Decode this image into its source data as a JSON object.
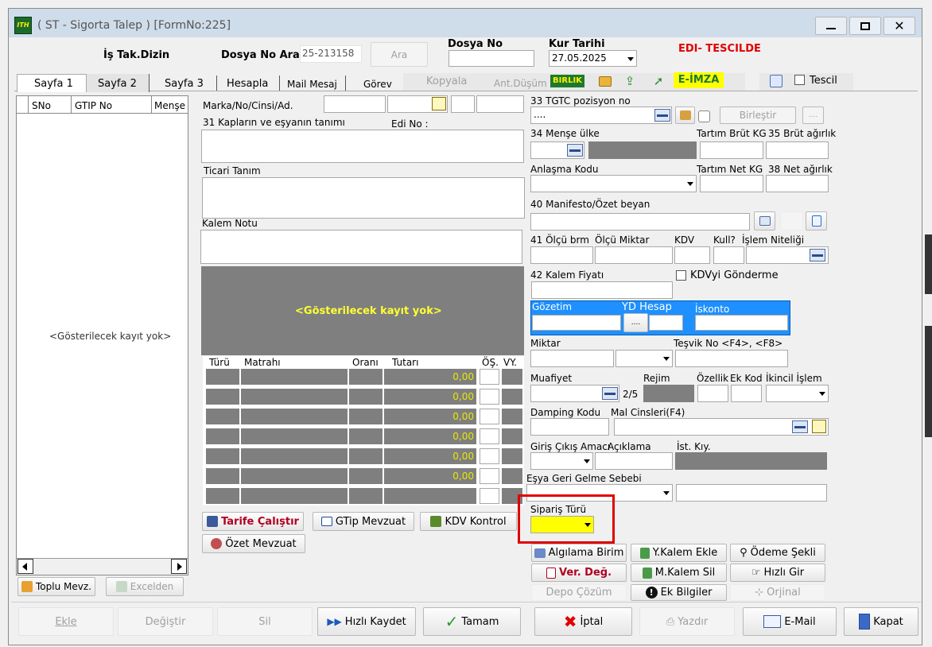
{
  "window": {
    "title": "( ST  - Sigorta Talep ) [FormNo:225]",
    "app_icon_text": "ITH"
  },
  "header": {
    "is_tak_dizin": "İş Tak.Dizin",
    "dosya_no_ara_label": "Dosya No Ara",
    "dosya_no_ara_value": "25-213158",
    "ara_button": "Ara",
    "dosya_no_label": "Dosya No",
    "dosya_no_value": "",
    "kur_tarihi_label": "Kur Tarihi",
    "kur_tarihi_value": "27.05.2025",
    "edi_status": "EDI- TESCILDE"
  },
  "tabs": [
    "Sayfa 1",
    "Sayfa 2",
    "Sayfa 3",
    "Hesapla",
    "Mail Mesaj",
    "Görev"
  ],
  "toolbar": {
    "kopyala": "Kopyala",
    "ant_dusum": "Ant.Düşüm",
    "birlik": "BIRLIK",
    "e_imza": "E-İMZA",
    "tescil": "Tescil"
  },
  "left_grid": {
    "columns": [
      "SNo",
      "GTIP No",
      "Menşe"
    ],
    "empty_text": "<Gösterilecek kayıt yok>",
    "toplu_mevz": "Toplu Mevz.",
    "excelden": "Excelden"
  },
  "mid": {
    "marka_label": "Marka/No/Cinsi/Ad.",
    "kaplar_label": "31 Kapların ve eşyanın tanımı",
    "edi_no_label": "Edi No :",
    "ticari_tanim_label": "Ticari Tanım",
    "kalem_notu_label": "Kalem Notu",
    "empty_text": "<Gösterilecek kayıt yok>",
    "tax_columns": [
      "Türü",
      "Matrahı",
      "Oranı",
      "Tutarı",
      "ÖŞ.",
      "VY."
    ],
    "tax_amounts": [
      "0,00",
      "0,00",
      "0,00",
      "0,00",
      "0,00",
      "0,00",
      ""
    ],
    "tarife_calistir": "Tarife Çalıştır",
    "gtip_mevzuat": "GTip Mevzuat",
    "kdv_kontrol": "KDV Kontrol",
    "ozet_mevzuat": "Özet Mevzuat"
  },
  "right": {
    "tgtc_label": "33 TGTC pozisyon no",
    "tgtc_value": "....",
    "birlestir": "Birleştir",
    "mense_label": "34 Menşe ülke",
    "tartim_brut_label": "Tartım Brüt KG",
    "brut_agirlik_label": "35 Brüt ağırlık",
    "anlasma_label": "Anlaşma Kodu",
    "tartim_net_label": "Tartım Net KG",
    "net_agirlik_label": "38 Net ağırlık",
    "manifesto_label": "40 Manifesto/Özet beyan",
    "olcu_brm_label": "41 Ölçü brm",
    "olcu_miktar_label": "Ölçü Miktar",
    "kdv_label": "KDV",
    "kull_label": "Kull?",
    "islem_niteligi_label": "İşlem Niteliği",
    "kalem_fiyati_label": "42 Kalem Fiyatı",
    "kdvyi_gonderme": "KDVyi Gönderme",
    "gozetim_label": "Gözetim",
    "yd_hesap_label": "YD Hesap",
    "iskonto_label": "İskonto",
    "miktar_label": "Miktar",
    "tesvik_label": "Teşvik No <F4>, <F8>",
    "muafiyet_label": "Muafiyet",
    "muafiyet_count": "2/5",
    "rejim_label": "Rejim",
    "ozellik_label": "Özellik",
    "ek_kod_label": "Ek Kod",
    "ikincil_label": "İkincil İşlem",
    "damping_label": "Damping Kodu",
    "mal_cinsleri_label": "Mal Cinsleri(F4)",
    "giris_cikis_label": "Giriş Çıkış Amacı",
    "aciklama_label": "Açıklama",
    "ist_kiy_label": "İst. Kıy.",
    "esya_geri_label": "Eşya Geri Gelme Sebebi",
    "siparis_turu_label": "Sipariş Türü"
  },
  "action_buttons": {
    "algilama_birim": "Algılama Birim",
    "y_kalem_ekle": "Y.Kalem Ekle",
    "odeme_sekli": "Ödeme Şekli",
    "ver_deg": "Ver. Değ.",
    "m_kalem_sil": "M.Kalem Sil",
    "hizli_gir": "Hızlı Gir",
    "depo_cozum": "Depo Çözüm",
    "ek_bilgiler": "Ek Bilgiler",
    "orjinal": "Orjinal"
  },
  "bottom_bar": {
    "ekle": "Ekle",
    "degistir": "Değiştir",
    "sil": "Sil",
    "hizli_kaydet": "Hızlı Kaydet",
    "tamam": "Tamam",
    "iptal": "İptal",
    "yazdir": "Yazdır",
    "email": "E-Mail",
    "kapat": "Kapat"
  },
  "colors": {
    "highlight_box": "#e00000",
    "siparis_fill": "#ffff00",
    "edi_red": "#e00000",
    "gozetim_blue": "#1e90ff",
    "gray_panel": "#7f7f7f",
    "amount_yellow": "#e8e800"
  }
}
